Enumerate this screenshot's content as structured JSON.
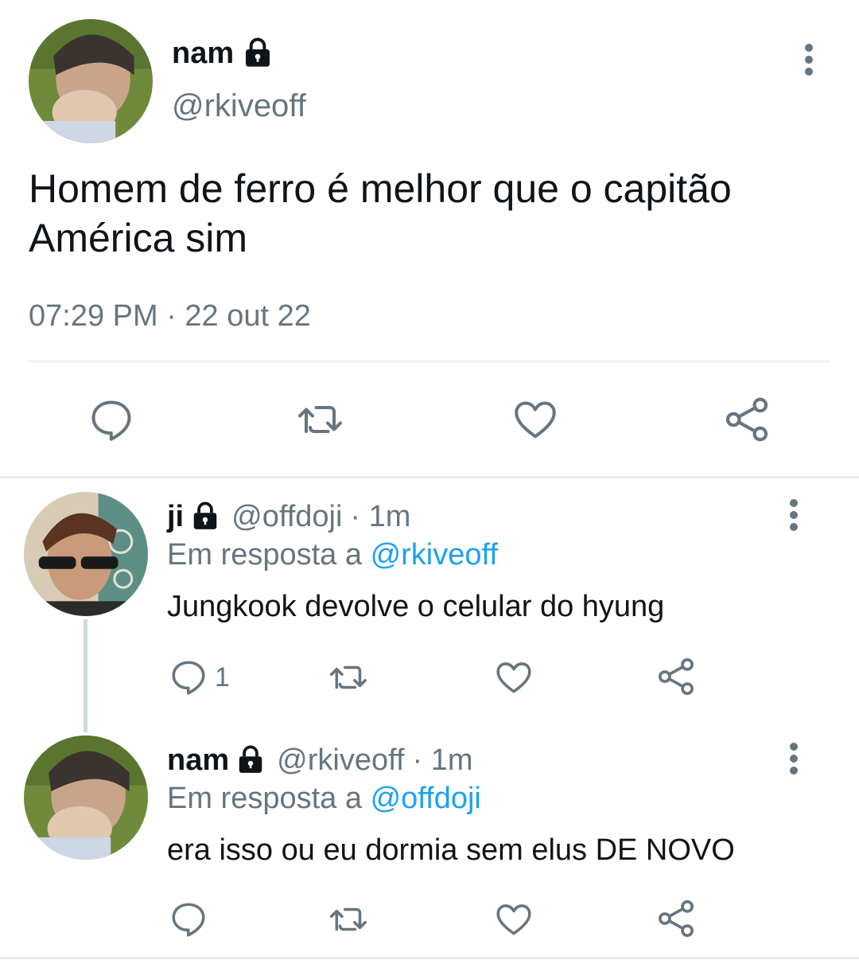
{
  "main_tweet": {
    "display_name": "nam",
    "handle": "@rkiveoff",
    "text": "Homem de ferro é melhor que o capitão América sim",
    "timestamp": "07:29 PM · 22 out 22",
    "actions": [
      "reply-icon",
      "retweet-icon",
      "like-icon",
      "share-icon"
    ]
  },
  "replies": [
    {
      "display_name": "ji",
      "handle": "@offdoji",
      "separator_time": "· 1m",
      "reply_prefix": "Em resposta a",
      "reply_to": "@rkiveoff",
      "text": "Jungkook devolve o celular do hyung",
      "reply_count": "1"
    },
    {
      "display_name": "nam",
      "handle": "@rkiveoff",
      "separator_time": "· 1m",
      "reply_prefix": "Em resposta a",
      "reply_to": "@offdoji",
      "text": "era isso ou eu dormia sem elus DE NOVO",
      "reply_count": ""
    }
  ],
  "colors": {
    "text": "#0f1419",
    "secondary": "#66757f",
    "link": "#1da1f2",
    "divider": "#e6ecf0"
  }
}
